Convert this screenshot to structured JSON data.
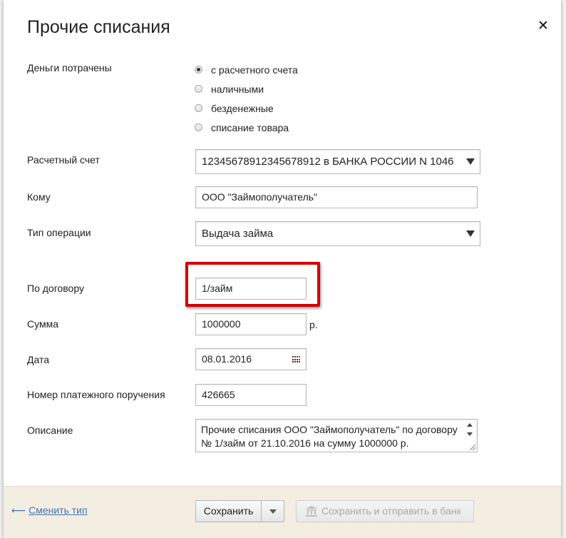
{
  "dialog": {
    "title": "Прочие списания",
    "close_label": "✕"
  },
  "form": {
    "money_spent": {
      "label": "Деньги потрачены",
      "options": [
        {
          "label": "с расчетного счета",
          "checked": true
        },
        {
          "label": "наличными",
          "checked": false
        },
        {
          "label": "безденежные",
          "checked": false
        },
        {
          "label": "списание товара",
          "checked": false
        }
      ]
    },
    "account": {
      "label": "Расчетный счет",
      "value": "12345678912345678912 в БАНКА РОССИИ N 1046"
    },
    "recipient": {
      "label": "Кому",
      "value": "ООО \"Займополучатель\""
    },
    "operation_type": {
      "label": "Тип операции",
      "value": "Выдача займа"
    },
    "contract": {
      "label": "По договору",
      "value": "1/займ"
    },
    "amount": {
      "label": "Сумма",
      "value": "1000000",
      "unit": "р."
    },
    "date": {
      "label": "Дата",
      "value": "08.01.2016"
    },
    "payment_order": {
      "label": "Номер платежного поручения",
      "value": "426665"
    },
    "description": {
      "label": "Описание",
      "value": "Прочие списания ООО \"Займополучатель\" по договору № 1/займ от 21.10.2016 на сумму 1000000 р."
    }
  },
  "footer": {
    "back_arrow": "⟵",
    "back_label": "Сменить тип",
    "save_label": "Сохранить",
    "save_send_label": "Сохранить и отправить в банк"
  },
  "colors": {
    "highlight": "#d40000",
    "link": "#3d77b5",
    "footer_bg": "#f3ede2"
  }
}
